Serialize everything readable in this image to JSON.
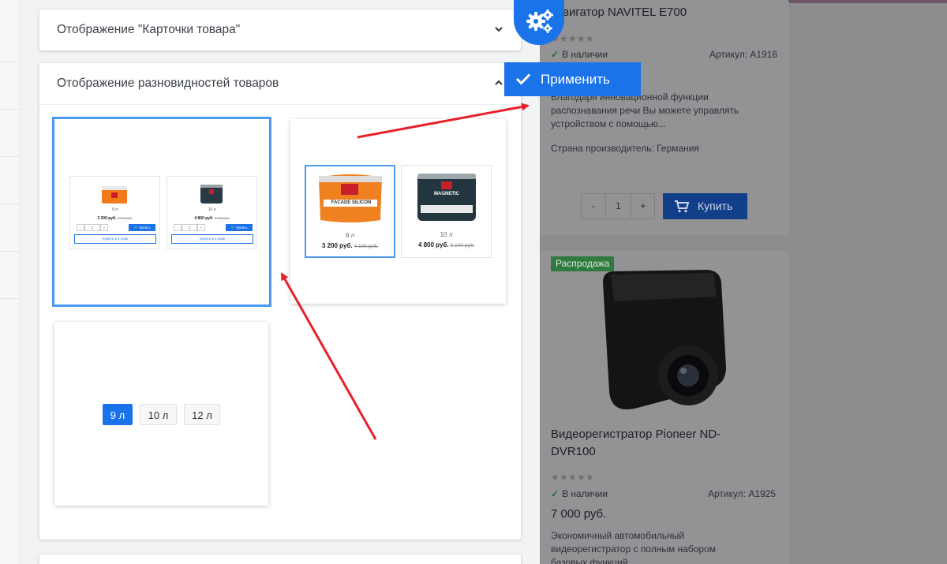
{
  "settings": {
    "sections": [
      {
        "title": "Отображение \"Карточки товара\""
      },
      {
        "title": "Отображение разновидностей товаров"
      }
    ],
    "option1": {
      "cards": [
        {
          "volume": "9 л",
          "price": "3 200 руб.",
          "old_price": "4 100 руб.",
          "buy": "Купить",
          "buy_one_click": "Купить в 1 клик"
        },
        {
          "volume": "10 л",
          "price": "4 800 руб.",
          "old_price": "5 100 руб.",
          "buy": "Купить",
          "buy_one_click": "Купить в 1 клик"
        }
      ],
      "qty": {
        "minus": "-",
        "value": "1",
        "plus": "+"
      }
    },
    "option2": {
      "cards": [
        {
          "volume": "9 л",
          "price": "3 200 руб.",
          "old_price": "4 100 руб.",
          "product_label": "FACADE SILICON"
        },
        {
          "volume": "10 л",
          "price": "4 800 руб.",
          "old_price": "5 100 руб.",
          "product_label": "MAGNETIC"
        }
      ]
    },
    "option3": {
      "chips": [
        "9 л",
        "10 л",
        "12 л"
      ],
      "selected": 0
    }
  },
  "apply_label": "Применить",
  "products": [
    {
      "title": "вигатор NAVITEL E700",
      "availability": "В наличии",
      "sku": "Артикул: А1916",
      "description_lines": [
        "Благодаря инновационной функции",
        "распознавания речи Вы можете управлять",
        "устройством с помощью..."
      ],
      "origin": "Страна производитель: Германия",
      "qty": {
        "minus": "-",
        "value": "1",
        "plus": "+"
      },
      "buy_label": "Купить"
    },
    {
      "badge": "Распродажа",
      "title_lines": [
        "Видеорегистратор Pioneer ND-",
        "DVR100"
      ],
      "availability": "В наличии",
      "sku": "Артикул: А1925",
      "price": "7 000 руб.",
      "description_lines": [
        "Экономичный автомобильный",
        "видеорегистратор с полным набором",
        "базовых функций"
      ]
    }
  ],
  "colors": {
    "accent": "#1a73e8",
    "selected_border": "#4a9af0",
    "arrow": "#e8202a",
    "sale_badge": "#2f7a3e"
  }
}
